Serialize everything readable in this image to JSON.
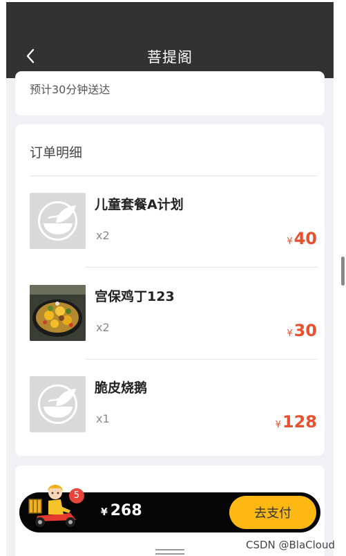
{
  "header": {
    "title": "菩提阁"
  },
  "partial_card": {
    "text": "预计30分钟送达"
  },
  "order": {
    "section_title": "订单明细",
    "items": [
      {
        "name": "儿童套餐A计划",
        "qty": "x2",
        "currency": "¥",
        "price": "40",
        "image": "placeholder-bowl-icon"
      },
      {
        "name": "宫保鸡丁123",
        "qty": "x2",
        "currency": "¥",
        "price": "30",
        "image": "food-photo"
      },
      {
        "name": "脆皮烧鹅",
        "qty": "x1",
        "currency": "¥",
        "price": "128",
        "image": "placeholder-bowl-icon"
      }
    ]
  },
  "cart": {
    "count": "5",
    "currency": "¥",
    "total": "268",
    "pay_label": "去支付"
  },
  "watermark": "CSDN @BlaCloud",
  "colors": {
    "header_bg": "#323232",
    "accent": "#e8502e",
    "pay_button": "#fdb813",
    "badge": "#e8443a",
    "cart_bar": "#050505"
  }
}
